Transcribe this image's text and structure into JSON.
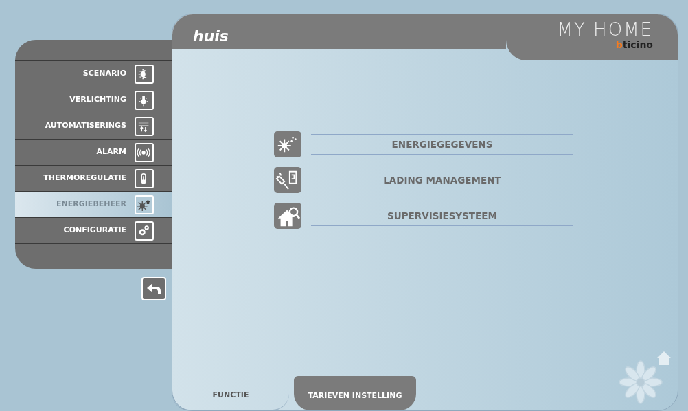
{
  "header": {
    "title": "huis",
    "logo": "MY HOME",
    "brand": "bticino"
  },
  "menu": [
    {
      "label": "SCENARIO",
      "selected": false
    },
    {
      "label": "VERLICHTING",
      "selected": false
    },
    {
      "label": "AUTOMATISERINGS",
      "selected": false
    },
    {
      "label": "ALARM",
      "selected": false
    },
    {
      "label": "THERMOREGULATIE",
      "selected": false
    },
    {
      "label": "ENERGIEBEHEER",
      "selected": true
    },
    {
      "label": "CONFIGURATIE",
      "selected": false
    }
  ],
  "options": [
    {
      "label": "ENERGIEGEGEVENS"
    },
    {
      "label": "LADING MANAGEMENT"
    },
    {
      "label": "SUPERVISIESYSTEEM"
    }
  ],
  "tabs": [
    {
      "label": "FUNCTIE",
      "selected": true
    },
    {
      "label": "TARIEVEN INSTELLING",
      "selected": false
    }
  ]
}
